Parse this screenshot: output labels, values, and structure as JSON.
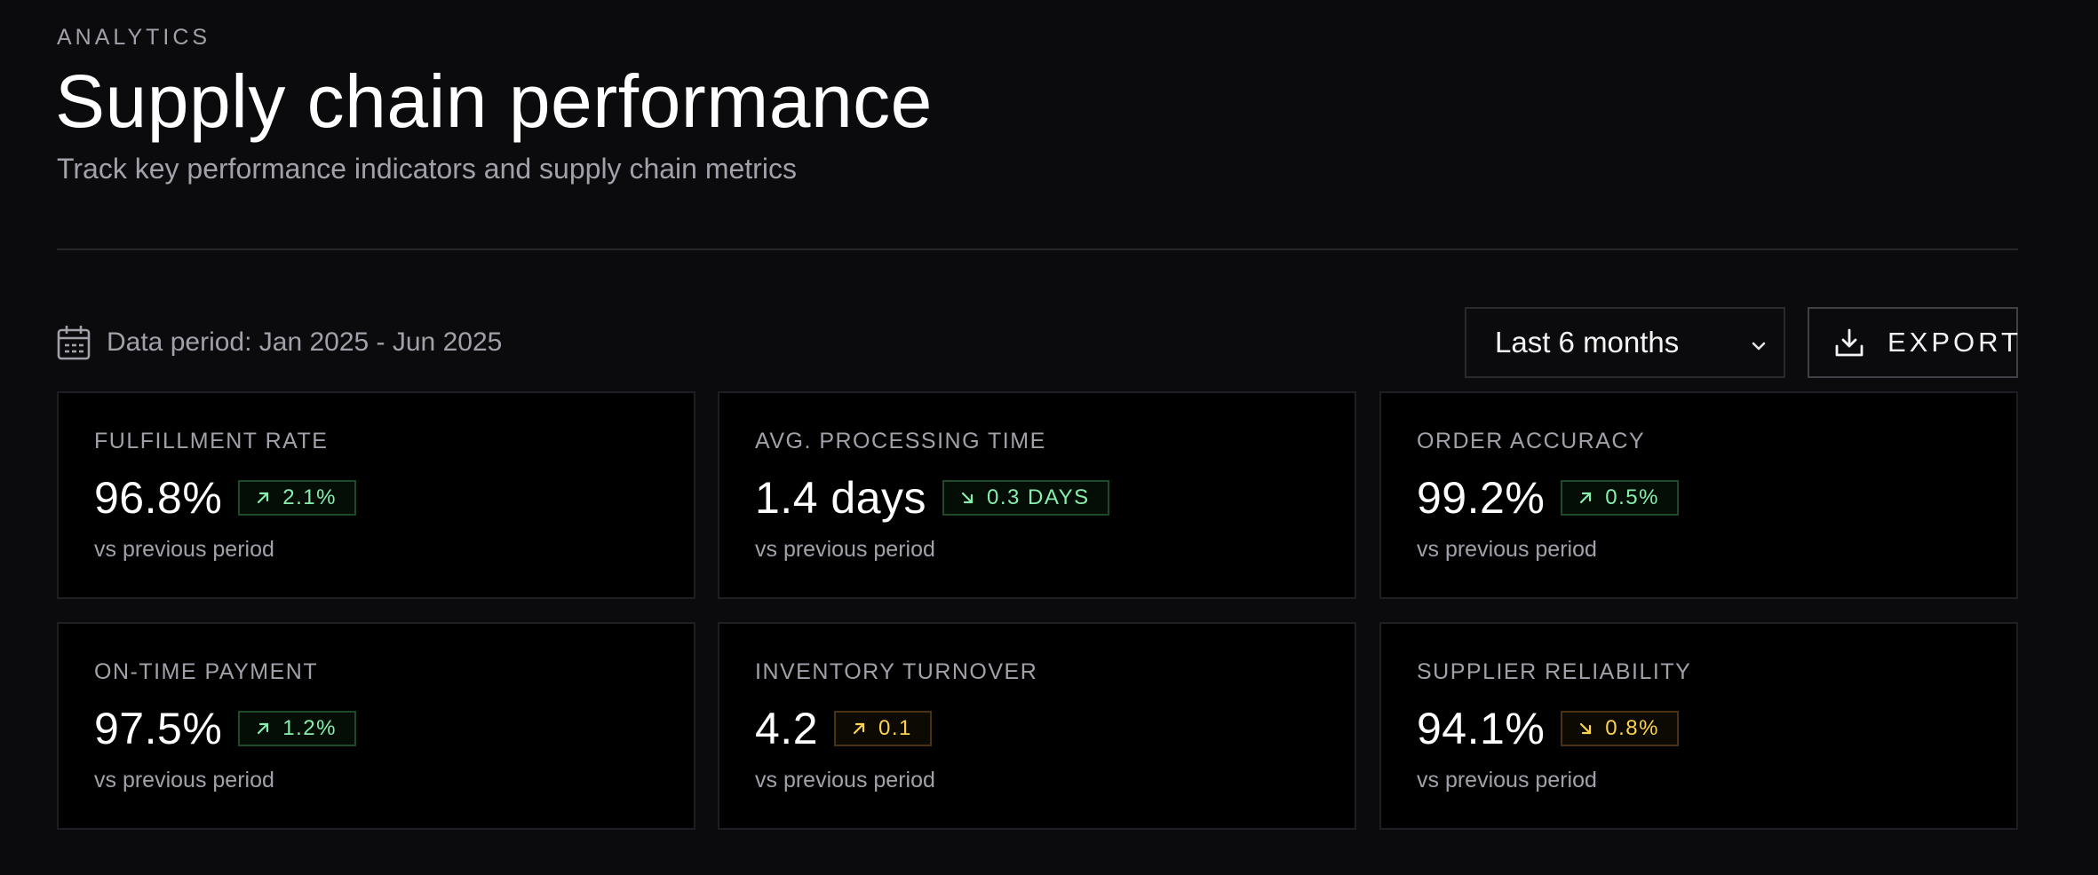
{
  "header": {
    "eyebrow": "ANALYTICS",
    "title": "Supply chain performance",
    "subtitle": "Track key performance indicators and supply chain metrics"
  },
  "toolbar": {
    "period_label": "Data period: Jan 2025 - Jun 2025",
    "period_icon": "calendar-icon",
    "range_select": {
      "selected": "Last 6 months"
    },
    "export_label": "EXPORT",
    "export_icon": "download-icon"
  },
  "colors": {
    "background": "#0b0b0d",
    "card_background": "#000000",
    "positive": "#86efac",
    "warning": "#fcd34d",
    "muted_text": "#a1a1aa"
  },
  "metrics": [
    {
      "label": "FULFILLMENT RATE",
      "value": "96.8%",
      "delta": "2.1%",
      "direction": "up",
      "tone": "good",
      "note": "vs previous period"
    },
    {
      "label": "AVG. PROCESSING TIME",
      "value": "1.4 days",
      "delta": "0.3 DAYS",
      "direction": "down",
      "tone": "good",
      "note": "vs previous period"
    },
    {
      "label": "ORDER ACCURACY",
      "value": "99.2%",
      "delta": "0.5%",
      "direction": "up",
      "tone": "good",
      "note": "vs previous period"
    },
    {
      "label": "ON-TIME PAYMENT",
      "value": "97.5%",
      "delta": "1.2%",
      "direction": "up",
      "tone": "good",
      "note": "vs previous period"
    },
    {
      "label": "INVENTORY TURNOVER",
      "value": "4.2",
      "delta": "0.1",
      "direction": "up",
      "tone": "warn",
      "note": "vs previous period"
    },
    {
      "label": "SUPPLIER RELIABILITY",
      "value": "94.1%",
      "delta": "0.8%",
      "direction": "down",
      "tone": "warn",
      "note": "vs previous period"
    }
  ]
}
